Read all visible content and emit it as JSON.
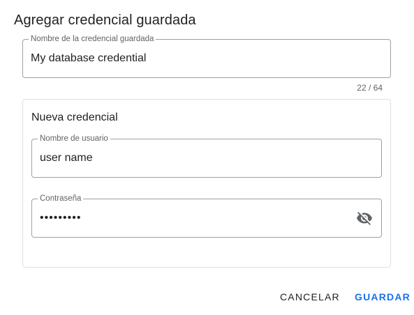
{
  "dialog": {
    "title": "Agregar credencial guardada",
    "credential_name": {
      "label": "Nombre de la credencial guardada",
      "value": "My database credential",
      "counter": "22 / 64"
    },
    "new_credential": {
      "title": "Nueva credencial",
      "username": {
        "label": "Nombre de usuario",
        "value": "user name"
      },
      "password": {
        "label": "Contraseña",
        "value": "•••••••••",
        "toggle_icon": "eye-off-icon"
      }
    },
    "actions": {
      "cancel_label": "CANCELAR",
      "save_label": "GUARDAR"
    }
  },
  "colors": {
    "accent": "#1a73e8",
    "text": "#202124",
    "secondary_text": "#5f6368",
    "outline": "#9aa0a6",
    "card_border": "#e0e0e0"
  }
}
